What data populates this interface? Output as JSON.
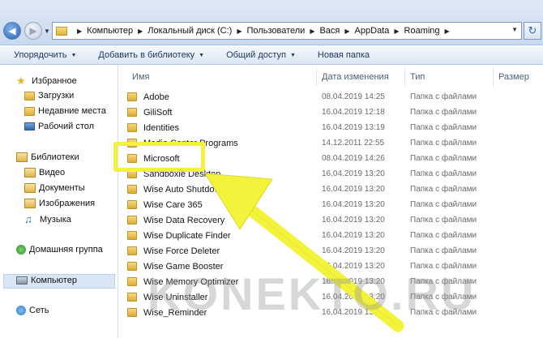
{
  "address": {
    "breadcrumbs": [
      "Компьютер",
      "Локальный диск (C:)",
      "Пользователи",
      "Вася",
      "AppData",
      "Roaming"
    ]
  },
  "toolbar": {
    "organize": "Упорядочить",
    "add_library": "Добавить в библиотеку",
    "share": "Общий доступ",
    "new_folder": "Новая папка"
  },
  "nav": {
    "favorites": "Избранное",
    "downloads": "Загрузки",
    "recent": "Недавние места",
    "desktop": "Рабочий стол",
    "libraries": "Библиотеки",
    "video": "Видео",
    "documents": "Документы",
    "images": "Изображения",
    "music": "Музыка",
    "homegroup": "Домашняя группа",
    "computer": "Компьютер",
    "network": "Сеть"
  },
  "columns": {
    "name": "Имя",
    "date": "Дата изменения",
    "type": "Тип",
    "size": "Размер"
  },
  "files": [
    {
      "name": "Adobe",
      "date": "08.04.2019 14:25",
      "type": "Папка с файлами"
    },
    {
      "name": "GiliSoft",
      "date": "16.04.2019 12:18",
      "type": "Папка с файлами"
    },
    {
      "name": "Identities",
      "date": "16.04.2019 13:19",
      "type": "Папка с файлами"
    },
    {
      "name": "Media Center Programs",
      "date": "14.12.2011 22:55",
      "type": "Папка с файлами"
    },
    {
      "name": "Microsoft",
      "date": "08.04.2019 14:26",
      "type": "Папка с файлами"
    },
    {
      "name": "Sandboxie Desktop",
      "date": "16.04.2019 13:20",
      "type": "Папка с файлами"
    },
    {
      "name": "Wise Auto Shutdown",
      "date": "16.04.2019 13:20",
      "type": "Папка с файлами"
    },
    {
      "name": "Wise Care 365",
      "date": "16.04.2019 13:20",
      "type": "Папка с файлами"
    },
    {
      "name": "Wise Data Recovery",
      "date": "16.04.2019 13:20",
      "type": "Папка с файлами"
    },
    {
      "name": "Wise Duplicate Finder",
      "date": "16.04.2019 13:20",
      "type": "Папка с файлами"
    },
    {
      "name": "Wise Force Deleter",
      "date": "16.04.2019 13:20",
      "type": "Папка с файлами"
    },
    {
      "name": "Wise Game Booster",
      "date": "16.04.2019 13:20",
      "type": "Папка с файлами"
    },
    {
      "name": "Wise Memory Optimizer",
      "date": "16.04.2019 13:20",
      "type": "Папка с файлами"
    },
    {
      "name": "Wise Uninstaller",
      "date": "16.04.2019 13:20",
      "type": "Папка с файлами"
    },
    {
      "name": "Wise_Reminder",
      "date": "16.04.2019 13:20",
      "type": "Папка с файлами"
    }
  ],
  "watermark": "KONEKTO.RU",
  "colors": {
    "highlight": "#f2f33a",
    "selection": "#d8e6f5"
  }
}
